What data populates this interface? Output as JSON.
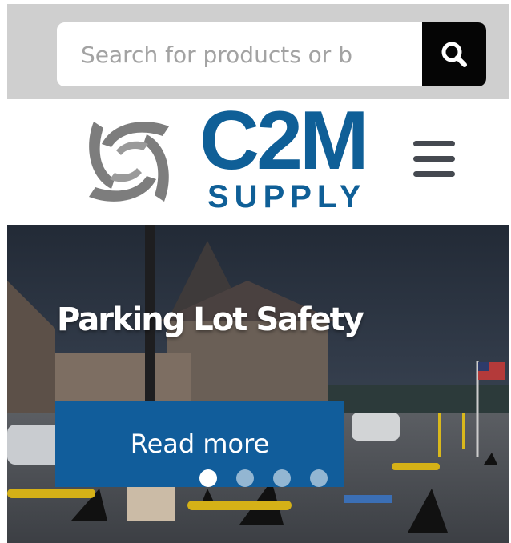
{
  "search": {
    "placeholder": "Search for products or b",
    "button_icon": "search-icon"
  },
  "brand": {
    "name_main": "C2M",
    "name_sub": "SUPPLY",
    "logo_icon": "swirl-logo-icon",
    "primary_color": "#0f5f97",
    "mark_color": "#808080"
  },
  "nav": {
    "menu_icon": "hamburger-menu-icon"
  },
  "hero": {
    "title": "Parking Lot Safety",
    "cta_label": "Read more",
    "cta_color": "#115d9b",
    "slides_total": 4,
    "active_slide": 1
  }
}
